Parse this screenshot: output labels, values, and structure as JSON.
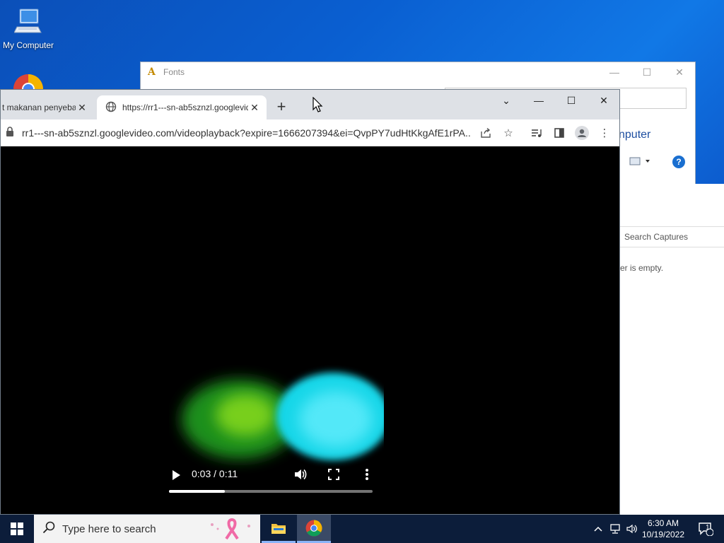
{
  "desktop": {
    "icons": [
      {
        "label": "My Computer",
        "icon": "computer-icon"
      },
      {
        "label": "",
        "icon": "chrome-icon"
      }
    ]
  },
  "fonts_window": {
    "title": "Fonts",
    "heading_fragment": "nputer",
    "help_label": "?"
  },
  "captures_window": {
    "search_placeholder": "Search Captures",
    "empty_text_fragment": "er is empty."
  },
  "browser": {
    "tabs": [
      {
        "title": "t makanan penyeba",
        "active": false
      },
      {
        "title": "https://rr1---sn-ab5sznzl.googlevideo.com",
        "active": true
      }
    ],
    "url": "rr1---sn-ab5sznzl.googlevideo.com/videoplayback?expire=1666207394&ei=QvpPY7udHtKkgAfE1rPA..."
  },
  "video": {
    "time_display": "0:03 / 0:11",
    "progress_fraction": 0.2727
  },
  "taskbar": {
    "search_placeholder": "Type here to search",
    "time": "6:30 AM",
    "date": "10/19/2022",
    "notification_count": "1"
  }
}
